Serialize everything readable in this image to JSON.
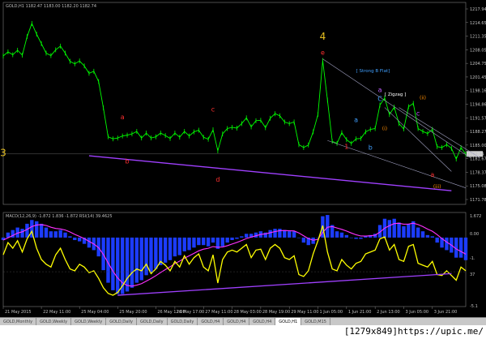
{
  "chart_data": {
    "type": "table",
    "price_panel": {
      "header": "GOLD,H1  1182.47 1183.00 1182.20 1182.74",
      "y_ticks": [
        "1217.94",
        "1214.65",
        "1211.35",
        "1208.05",
        "1204.75",
        "1201.45",
        "1198.16",
        "1194.86",
        "1191.57",
        "1188.27",
        "1185.00",
        "1181.67",
        "1178.37",
        "1175.08",
        "1171.78"
      ],
      "ylim": [
        1170.5,
        1219.5
      ],
      "current_price": "1182.74",
      "current_price_value": 1182.74,
      "wave_labels": [
        {
          "text": "4",
          "color": "#e8c020",
          "x": 67,
          "y": 1210.4
        },
        {
          "text": "e",
          "color": "#ff3030",
          "x": 67,
          "y": 1206.8
        },
        {
          "text": "3",
          "color": "#e8c020",
          "x": 0,
          "y": 1182.2
        },
        {
          "text": "a",
          "color": "#ff3030",
          "x": 25,
          "y": 1191.2
        },
        {
          "text": "b",
          "color": "#ff3030",
          "x": 26,
          "y": 1180.4
        },
        {
          "text": "c",
          "color": "#ff3030",
          "x": 44,
          "y": 1193.0
        },
        {
          "text": "d",
          "color": "#ff3030",
          "x": 45,
          "y": 1176.0
        },
        {
          "text": "a",
          "color": "#c060ff",
          "x": 79,
          "y": 1197.8
        },
        {
          "text": "C",
          "color": "#40a0ff",
          "x": 79,
          "y": 1195.6
        },
        {
          "text": "a",
          "color": "#40a0ff",
          "x": 74,
          "y": 1190.5
        },
        {
          "text": "b",
          "color": "#40a0ff",
          "x": 77,
          "y": 1183.8
        },
        {
          "text": "(i)",
          "color": "#ff8c00",
          "x": 80,
          "y": 1188.5
        },
        {
          "text": "c",
          "color": "#c060ff",
          "x": 87,
          "y": 1192.0
        },
        {
          "text": "(ii)",
          "color": "#ff8c00",
          "x": 88,
          "y": 1196.0
        },
        {
          "text": "(iii)",
          "color": "#ff8c00",
          "x": 91,
          "y": 1174.4
        },
        {
          "text": "1",
          "color": "#ff3030",
          "x": 72,
          "y": 1184.0
        },
        {
          "text": "a",
          "color": "#ff3030",
          "x": 90,
          "y": 1177.2
        }
      ],
      "annotations": [
        {
          "text": "[ Strong B Flat]",
          "color": "#40a0ff",
          "x": 74,
          "y": 1202.6
        },
        {
          "text": "[ Zigzag ]",
          "color": "#ffffff",
          "x": 80,
          "y": 1196.9
        }
      ]
    },
    "macd_panel": {
      "header": "MACD(12,26,9) -1.872  1.836  -1.872  RSI(14) 39.4625",
      "y_ticks": [
        "1.672",
        "0.00",
        "-1.",
        "37",
        "-5.1"
      ],
      "rsi_ylim": [
        0,
        100
      ],
      "macd_ylim": [
        -5.5,
        2.0
      ]
    },
    "x_ticks": [
      "21 May 2015",
      "22 May 11:00",
      "25 May 04:00",
      "25 May 20:00",
      "26 May 12:00",
      "26 May 17:00",
      "27 May 11:00",
      "28 May 03:00",
      "28 May 19:00",
      "29 May 11:00",
      "1 Jun 05:00",
      "1 Jun 21:00",
      "2 Jun 13:00",
      "3 Jun 05:00",
      "3 Jun 21:00"
    ],
    "x_tick_index": [
      0,
      8,
      16,
      24,
      32,
      36,
      42,
      48,
      54,
      60,
      66,
      72,
      78,
      84,
      90
    ],
    "price": [
      1206.5,
      1207.5,
      1206.8,
      1207.9,
      1206.7,
      1211.2,
      1214.4,
      1211.8,
      1209.5,
      1207.2,
      1206.6,
      1208.0,
      1208.9,
      1207.2,
      1205.2,
      1204.6,
      1205.3,
      1204.1,
      1202.3,
      1202.8,
      1200.3,
      1193.9,
      1186.9,
      1186.4,
      1186.6,
      1187.1,
      1187.3,
      1187.6,
      1188.2,
      1186.6,
      1187.8,
      1186.6,
      1186.9,
      1187.8,
      1187.2,
      1186.5,
      1187.8,
      1186.8,
      1188.2,
      1187.1,
      1188.1,
      1188.5,
      1186.8,
      1186.3,
      1188.6,
      1183.5,
      1187.6,
      1188.9,
      1189.2,
      1189.0,
      1190.1,
      1191.5,
      1189.3,
      1190.8,
      1190.9,
      1189.1,
      1191.4,
      1192.5,
      1192.0,
      1190.5,
      1190.1,
      1190.5,
      1185.0,
      1184.3,
      1184.9,
      1188.1,
      1192.3,
      1205.4,
      1195.8,
      1185.8,
      1185.3,
      1187.9,
      1186.2,
      1185.3,
      1186.4,
      1186.5,
      1188.1,
      1188.7,
      1188.9,
      1194.6,
      1196.3,
      1192.3,
      1194.1,
      1190.1,
      1188.8,
      1194.2,
      1195.0,
      1188.9,
      1188.2,
      1187.7,
      1188.7,
      1184.5,
      1184.3,
      1185.0,
      1184.1,
      1181.5,
      1184.3,
      1182.7
    ],
    "rsi": [
      55,
      68,
      62,
      70,
      58,
      72,
      80,
      62,
      50,
      45,
      42,
      55,
      62,
      50,
      40,
      38,
      45,
      42,
      36,
      38,
      30,
      20,
      14,
      12,
      15,
      22,
      30,
      36,
      40,
      38,
      45,
      35,
      40,
      48,
      44,
      38,
      48,
      42,
      54,
      45,
      52,
      56,
      42,
      38,
      55,
      25,
      50,
      58,
      60,
      58,
      62,
      66,
      52,
      60,
      61,
      50,
      62,
      66,
      62,
      52,
      50,
      54,
      34,
      32,
      38,
      56,
      70,
      86,
      58,
      40,
      38,
      50,
      44,
      40,
      46,
      48,
      56,
      58,
      60,
      72,
      74,
      60,
      66,
      50,
      48,
      64,
      66,
      46,
      44,
      42,
      48,
      34,
      33,
      38,
      33,
      28,
      42,
      38
    ],
    "macd": [
      -0.2,
      0.4,
      0.6,
      0.8,
      0.7,
      1.1,
      1.4,
      1.3,
      1.1,
      0.8,
      0.5,
      0.5,
      0.6,
      0.4,
      0.1,
      -0.2,
      -0.3,
      -0.5,
      -0.8,
      -1.0,
      -1.5,
      -2.6,
      -3.6,
      -4.2,
      -4.5,
      -4.5,
      -4.3,
      -4.0,
      -3.6,
      -3.4,
      -3.0,
      -2.8,
      -2.5,
      -2.2,
      -2.0,
      -1.8,
      -1.5,
      -1.4,
      -1.1,
      -1.0,
      -0.8,
      -0.6,
      -0.6,
      -0.7,
      -0.4,
      -0.9,
      -0.7,
      -0.4,
      -0.2,
      -0.1,
      0.1,
      0.3,
      0.3,
      0.4,
      0.5,
      0.4,
      0.6,
      0.7,
      0.7,
      0.6,
      0.5,
      0.5,
      0.0,
      -0.4,
      -0.6,
      -0.5,
      0.0,
      1.7,
      1.8,
      1.0,
      0.5,
      0.4,
      0.2,
      0.0,
      -0.1,
      -0.1,
      0.1,
      0.2,
      0.3,
      1.0,
      1.5,
      1.4,
      1.5,
      1.2,
      0.9,
      1.1,
      1.3,
      0.8,
      0.5,
      0.2,
      0.1,
      -0.4,
      -0.8,
      -1.0,
      -1.2,
      -1.6,
      -1.6,
      -1.8
    ]
  }
}
